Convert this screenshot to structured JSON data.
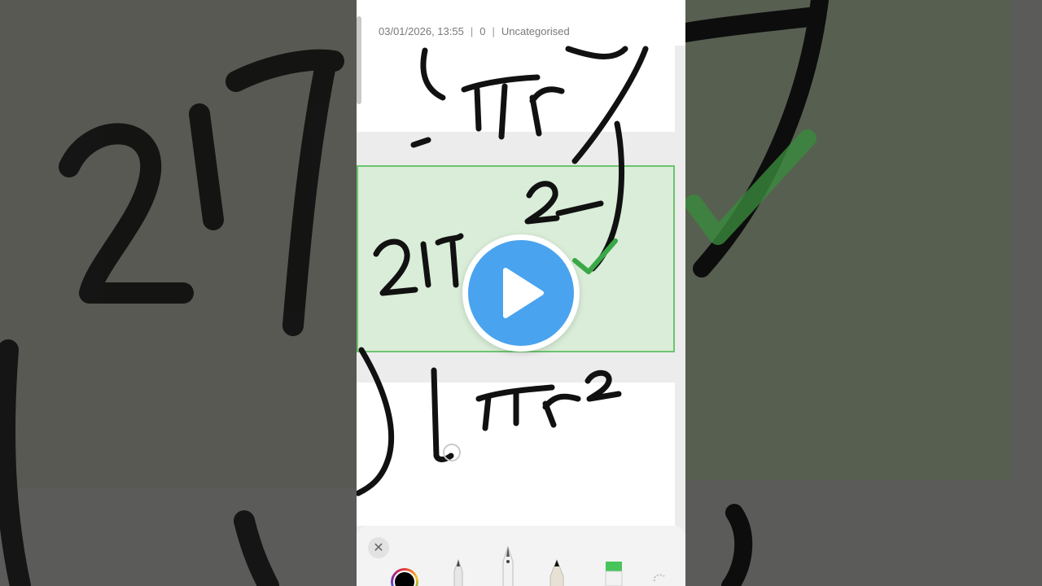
{
  "note": {
    "timestamp": "03/01/2026, 13:55",
    "count": "0",
    "category": "Uncategorised"
  },
  "handwriting": {
    "top": "πr",
    "middle": "2πr²",
    "bottom": "πr²"
  },
  "toolbar": {
    "close_label": "✕",
    "tools": [
      "color-picker",
      "fine-pen",
      "fountain-pen",
      "pencil",
      "highlighter",
      "lasso"
    ]
  },
  "overlay": {
    "play_icon": "play-icon"
  },
  "colors": {
    "highlight_fill": "#d9edd8",
    "highlight_border": "#6cc46f",
    "play_button": "#4aa3ee",
    "ink": "#111111"
  }
}
